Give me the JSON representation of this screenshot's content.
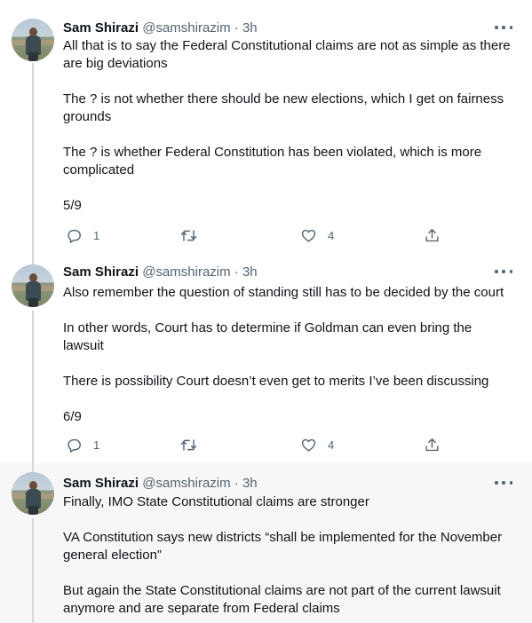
{
  "author": {
    "name": "Sam Shirazi",
    "handle": "@samshirazim",
    "separator": "·"
  },
  "tweets": [
    {
      "time": "3h",
      "paragraphs": [
        "All that is to say the Federal Constitutional claims are not as simple as there are big deviations",
        "The ? is not whether there should be new elections, which I get on fairness grounds",
        "The ? is whether Federal Constitution has been violated, which is more complicated",
        "5/9"
      ],
      "replies": "1",
      "retweets": "",
      "likes": "4"
    },
    {
      "time": "3h",
      "paragraphs": [
        "Also remember the question of standing still has to be decided by the court",
        "In other words, Court has to determine if Goldman can even bring the lawsuit",
        "There is possibility Court doesn’t even get to merits I’ve been discussing",
        "6/9"
      ],
      "replies": "1",
      "retweets": "",
      "likes": "4"
    },
    {
      "time": "3h",
      "paragraphs": [
        "Finally, IMO State Constitutional claims are stronger",
        "VA Constitution says new districts “shall be implemented for the November general election”",
        "But again the State Constitutional claims are not part of the current lawsuit anymore and are separate from Federal claims"
      ]
    }
  ],
  "icons": {
    "more": "more-icon",
    "reply": "reply-icon",
    "retweet": "retweet-icon",
    "like": "like-icon",
    "share": "share-icon"
  },
  "colors": {
    "text": "#0f1419",
    "secondary": "#536471",
    "thread_line": "#cfd9de",
    "highlight_bg": "#f7f7f7"
  }
}
